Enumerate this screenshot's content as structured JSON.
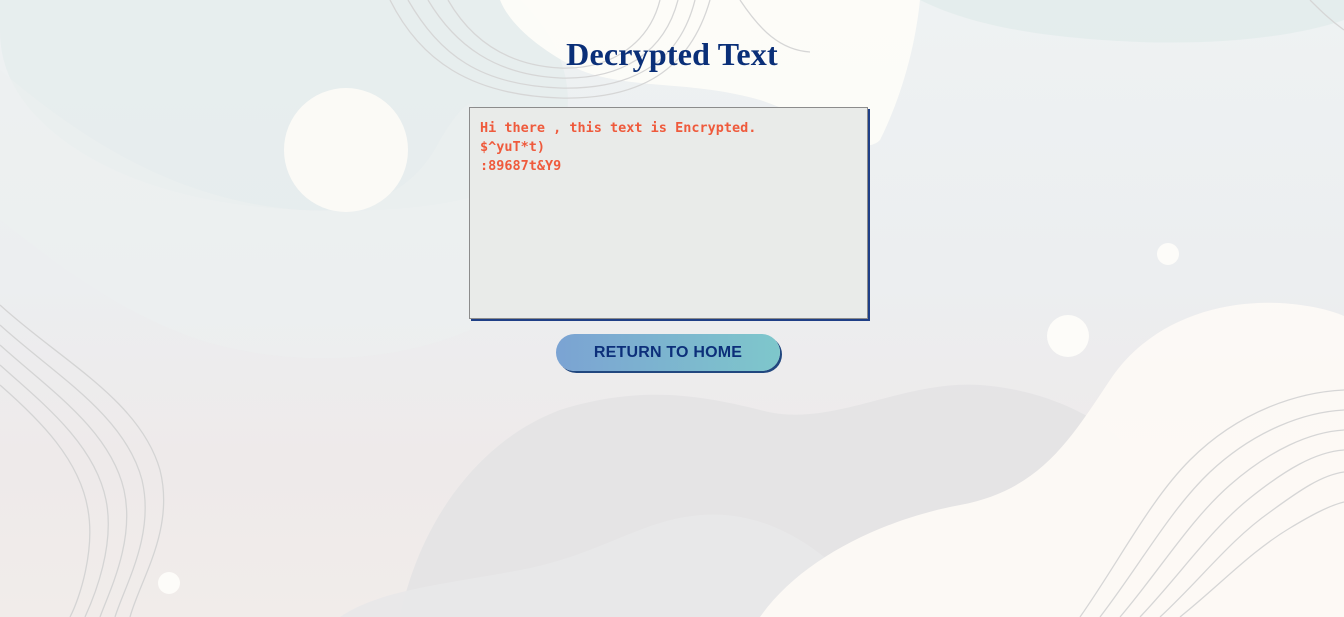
{
  "page": {
    "title": "Decrypted Text"
  },
  "decrypted_output": {
    "text": "Hi there , this text is Encrypted.\n$^yuT*t)\n:89687t&Y9"
  },
  "actions": {
    "return_label": "RETURN TO HOME"
  },
  "colors": {
    "title": "#0a2f78",
    "output_text": "#ef5a3c",
    "button_start": "#7ba3d3",
    "button_end": "#7ec7cb",
    "button_text": "#0c2f7a"
  }
}
